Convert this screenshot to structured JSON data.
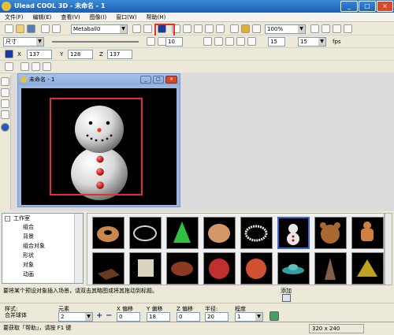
{
  "window": {
    "title": "Ulead COOL 3D - 未命名 - 1"
  },
  "menu": [
    "文件(F)",
    "编辑(E)",
    "查看(V)",
    "图像(I)",
    "窗口(W)",
    "帮助(H)"
  ],
  "toolbar1": {
    "object_select": "Metaball0",
    "zoom": "100%"
  },
  "toolbar2": {
    "size_select": "尺寸",
    "frame_value": "10",
    "frames": "15",
    "fps_label": "fps"
  },
  "toolbar3": {
    "x_label": "X",
    "x_value": "137",
    "y_label": "Y",
    "y_value": "128",
    "z_label": "Z",
    "z_value": "137"
  },
  "document": {
    "title": "未命名 - 1"
  },
  "tree": {
    "root": "工作室",
    "items": [
      "组合",
      "背景",
      "组合对象",
      "形状",
      "对象",
      "动画"
    ]
  },
  "gallery": {
    "items": [
      "donut",
      "ring",
      "cone",
      "disc",
      "pearl-necklace",
      "snowman",
      "teddy-bear",
      "gingerbread",
      "box",
      "key",
      "football",
      "ball-red",
      "ball-orange",
      "ufo",
      "drill",
      "pyramid"
    ]
  },
  "hint": "要将某个预设对象插入场景，请双击其略图或将其拖动到标题。",
  "add": {
    "label": "添加"
  },
  "bottom": {
    "style_label": "样式:",
    "style_value": "合并球体",
    "elements_label": "元素",
    "elements_value": "2",
    "x_offset_label": "X 偏移",
    "x_offset_value": "0",
    "y_offset_label": "Y 偏移",
    "y_offset_value": "18",
    "z_offset_label": "Z 偏移",
    "z_offset_value": "0",
    "radius_label": "半径:",
    "radius_value": "20",
    "degree_label": "程度",
    "degree_value": "1"
  },
  "status": {
    "left": "要获取「帮助」，请按 F1 键",
    "size": "320 x 240"
  }
}
